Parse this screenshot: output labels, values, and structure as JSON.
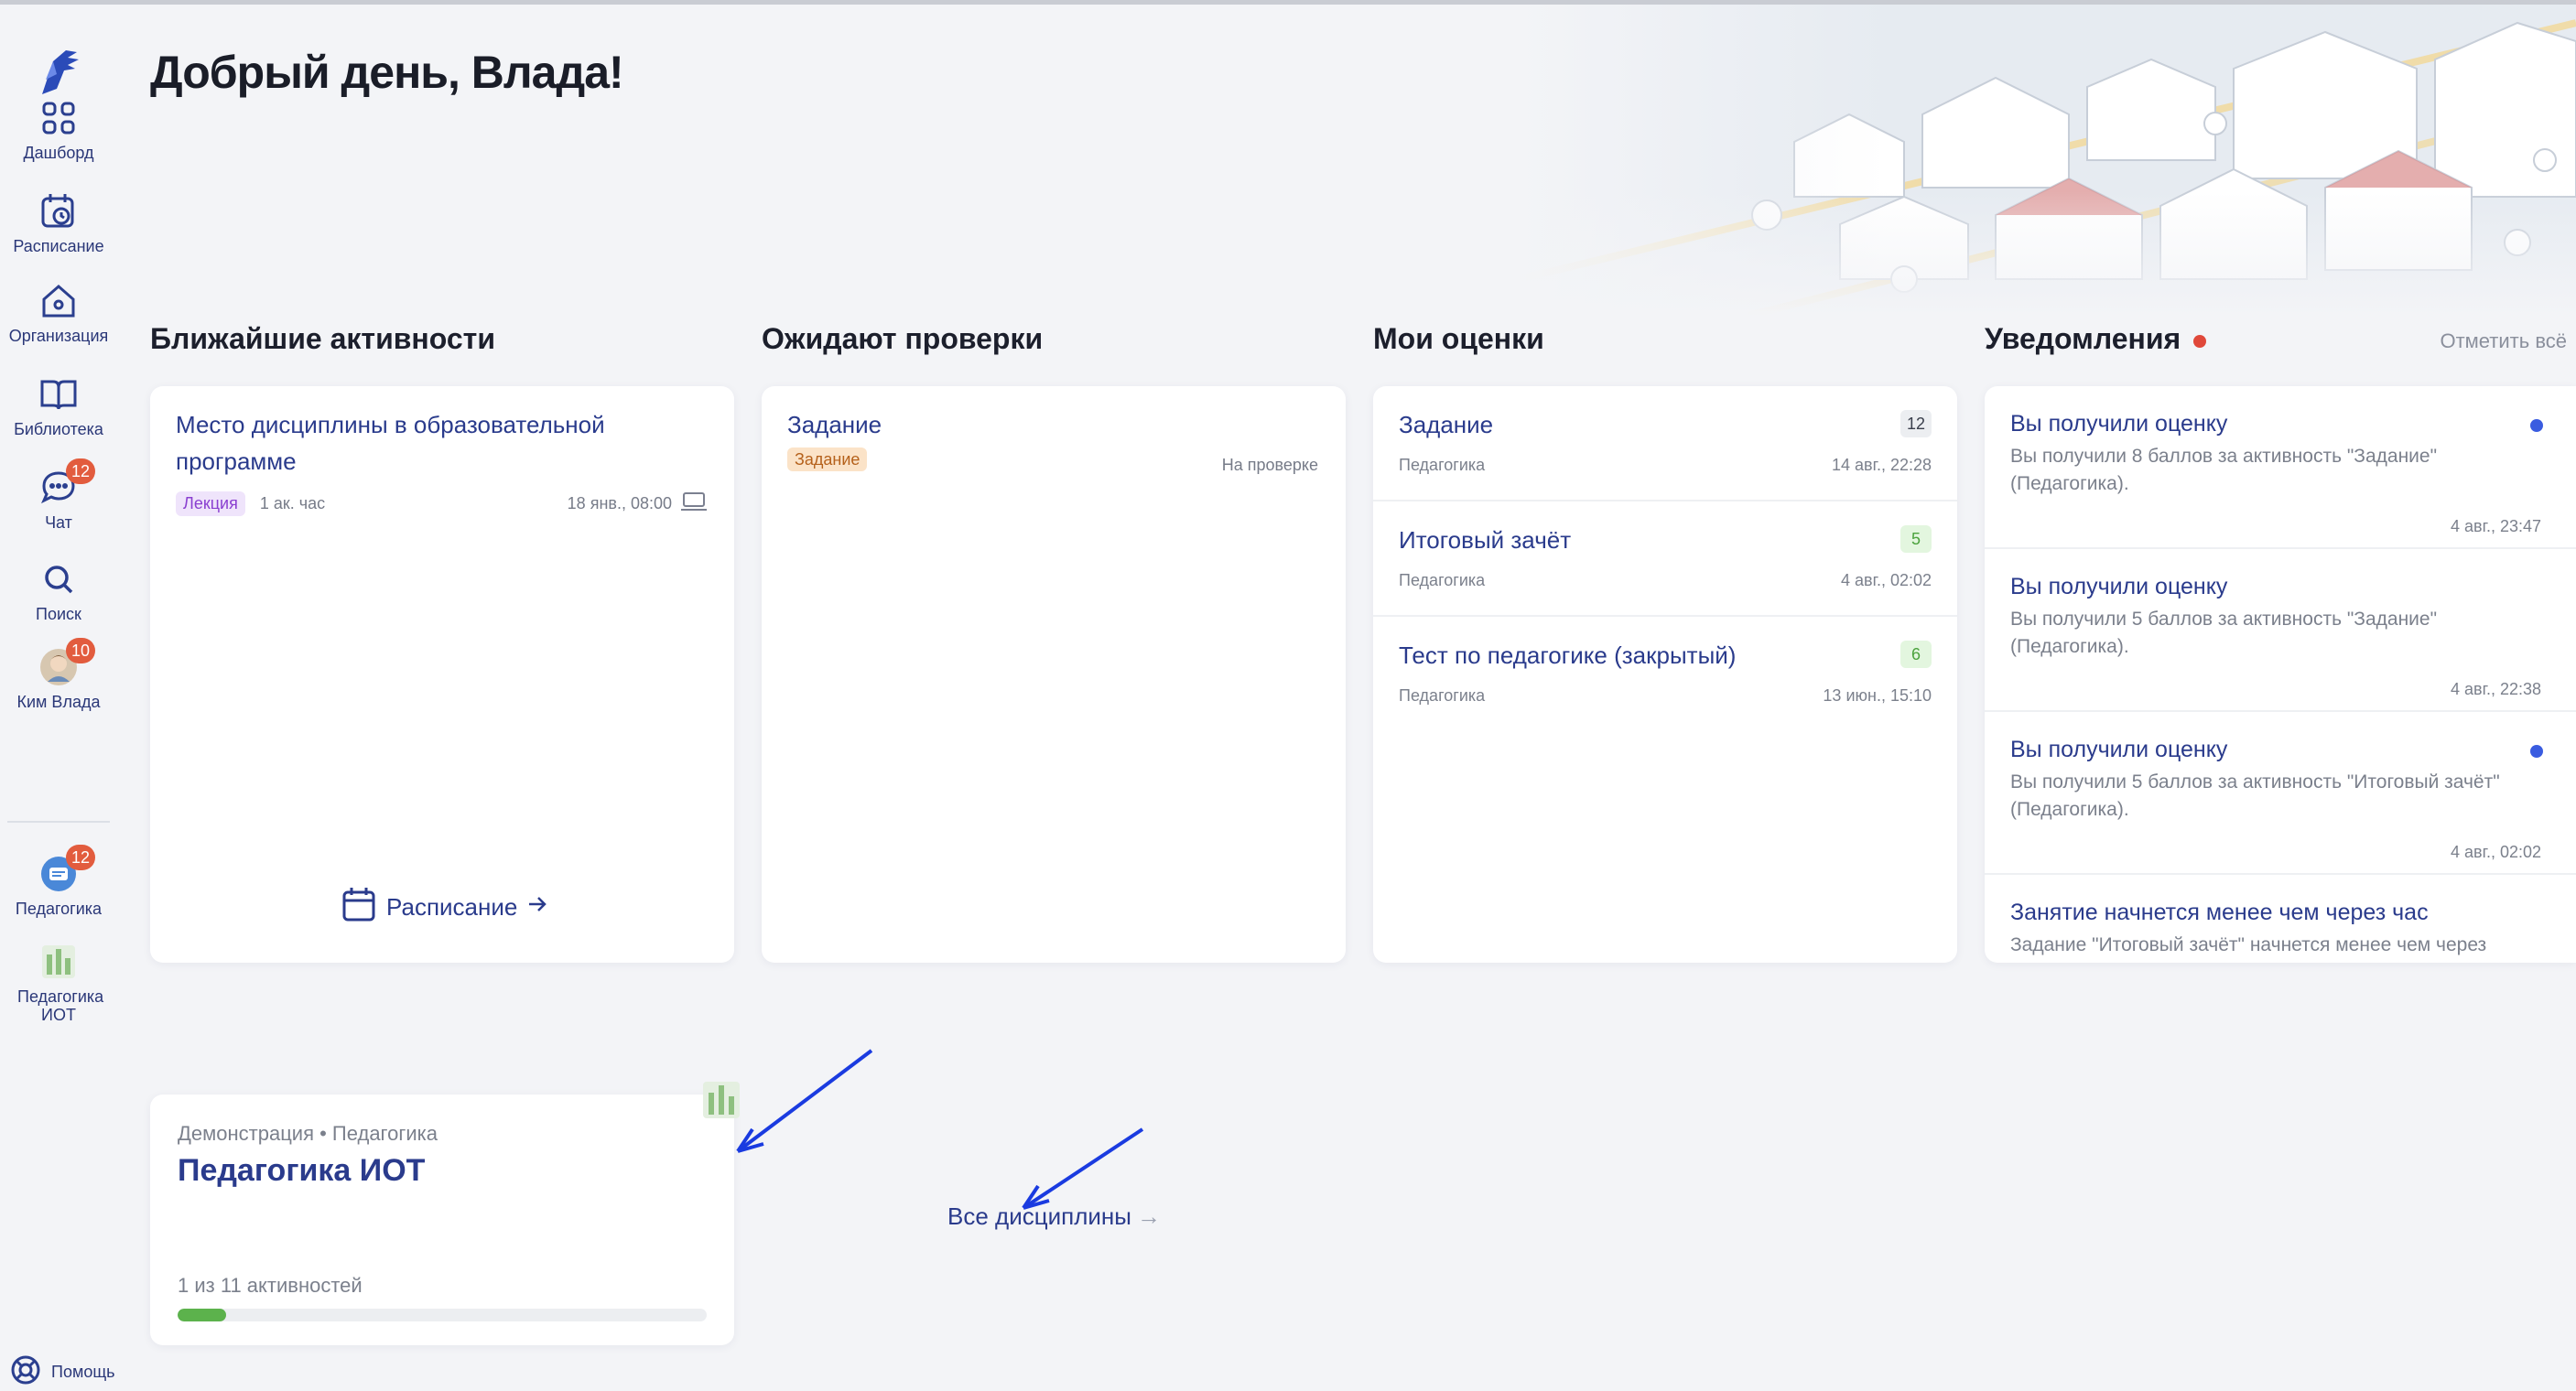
{
  "sidebar": {
    "items": [
      {
        "label": "Дашборд",
        "icon": "grid-icon"
      },
      {
        "label": "Расписание",
        "icon": "calendar-clock-icon"
      },
      {
        "label": "Организация",
        "icon": "home-icon"
      },
      {
        "label": "Библиотека",
        "icon": "book-icon"
      },
      {
        "label": "Чат",
        "icon": "chat-icon",
        "badge": "12"
      },
      {
        "label": "Поиск",
        "icon": "search-icon"
      },
      {
        "label": "Ким Влада",
        "icon": "avatar",
        "badge": "10"
      },
      {
        "label": "Педагогика",
        "icon": "course-icon",
        "badge": "12"
      },
      {
        "label": "Педагогика ИОТ",
        "icon": "building-icon"
      }
    ],
    "help_label": "Помощь"
  },
  "header": {
    "greeting": "Добрый день, Влада!"
  },
  "sections": {
    "activities": "Ближайшие активности",
    "review": "Ожидают проверки",
    "grades": "Мои оценки",
    "notifications": "Уведомления",
    "mark_all": "Отметить всё"
  },
  "activity": {
    "title": "Место дисциплины в образовательной программе",
    "tag": "Лекция",
    "duration": "1 ак. час",
    "date": "18 янв., 08:00",
    "schedule_link": "Расписание"
  },
  "review": {
    "title": "Задание",
    "tag": "Задание",
    "status": "На проверке"
  },
  "grades": [
    {
      "title": "Задание",
      "subject": "Педагогика",
      "date": "14 авг., 22:28",
      "score": "12",
      "style": "gray"
    },
    {
      "title": "Итоговый зачёт",
      "subject": "Педагогика",
      "date": "4 авг., 02:02",
      "score": "5",
      "style": "green"
    },
    {
      "title": "Тест по педагогике (закрытый)",
      "subject": "Педагогика",
      "date": "13 июн., 15:10",
      "score": "6",
      "style": "green"
    }
  ],
  "notifications": [
    {
      "title": "Вы получили оценку",
      "text": "Вы получили 8 баллов за активность \"Задание\" (Педагогика).",
      "date": "4 авг., 23:47",
      "unread": true
    },
    {
      "title": "Вы получили оценку",
      "text": "Вы получили 5 баллов за активность \"Задание\" (Педагогика).",
      "date": "4 авг., 22:38",
      "unread": false
    },
    {
      "title": "Вы получили оценку",
      "text": "Вы получили 5 баллов за активность \"Итоговый зачёт\" (Педагогика).",
      "date": "4 авг., 02:02",
      "unread": true
    },
    {
      "title": "Занятие начнется менее чем через час",
      "text": "Задание \"Итоговый зачёт\" начнется менее чем через",
      "date": "",
      "unread": false
    }
  ],
  "discipline": {
    "subtitle": "Демонстрация • Педагогика",
    "title": "Педагогика ИОТ",
    "progress_text": "1 из 11 активностей",
    "progress_fraction": 0.0909
  },
  "all_disciplines": "Все дисциплины",
  "colors": {
    "accent": "#2a3b8c",
    "badge": "#e25c3e",
    "progress": "#5cb24c",
    "unread_dot": "#3a5ce0",
    "annotation_arrow": "#1a3be0"
  }
}
